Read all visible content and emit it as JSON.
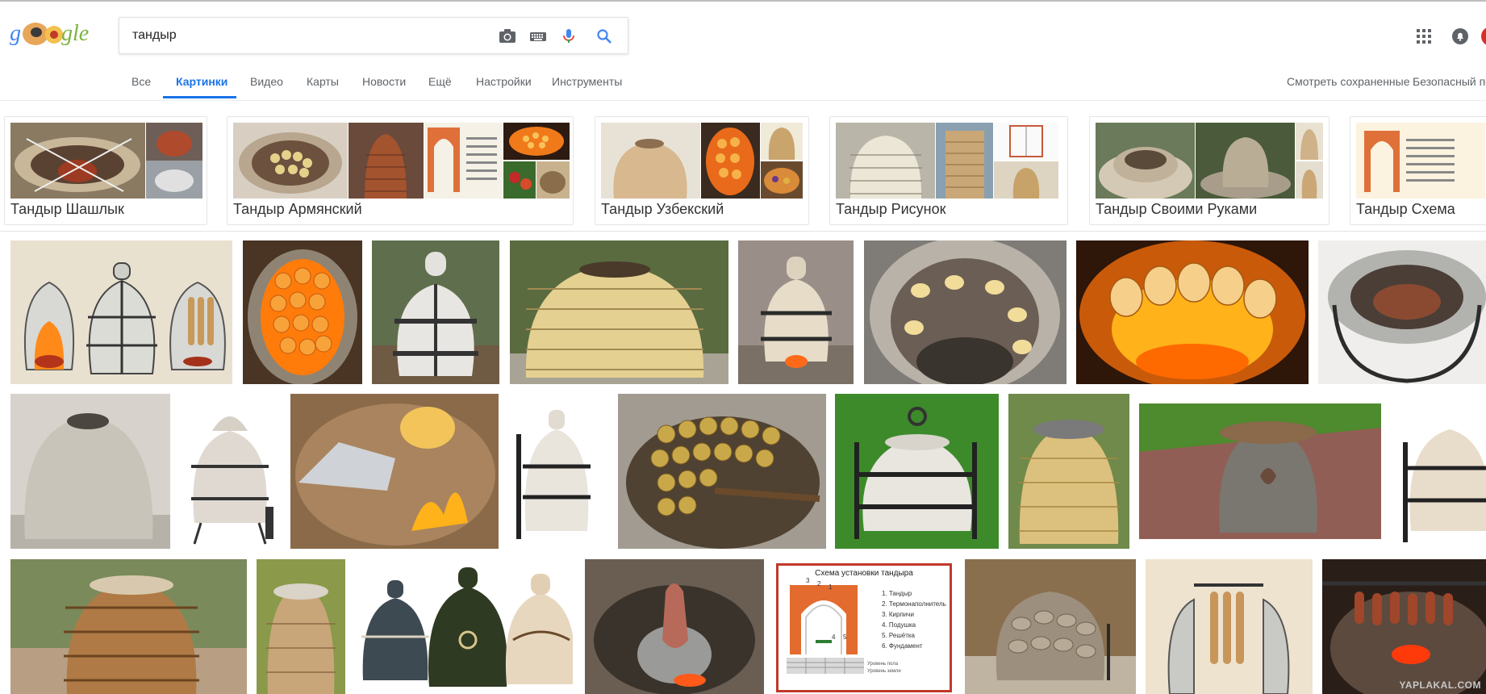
{
  "header": {
    "logo_text": "gle",
    "search_query": "тандыр",
    "icons": [
      "camera-icon",
      "keyboard-icon",
      "mic-icon",
      "search-icon",
      "apps-icon",
      "notifications-icon"
    ],
    "colors": {
      "accent": "#1a73e8",
      "mic_blue": "#4285f4",
      "mic_red": "#ea4335"
    }
  },
  "tabs": [
    {
      "label": "Все",
      "active": false
    },
    {
      "label": "Картинки",
      "active": true
    },
    {
      "label": "Видео",
      "active": false
    },
    {
      "label": "Карты",
      "active": false
    },
    {
      "label": "Новости",
      "active": false
    },
    {
      "label": "Ещё",
      "active": false
    },
    {
      "label": "Настройки",
      "active": false
    },
    {
      "label": "Инструменты",
      "active": false
    }
  ],
  "right_links": {
    "saved": "Смотреть сохраненные",
    "safe_search": "Безопасный по"
  },
  "related": [
    {
      "label": "Тандыр Шашлык"
    },
    {
      "label": "Тандыр Армянский"
    },
    {
      "label": "Тандыр Узбекский"
    },
    {
      "label": "Тандыр Рисунок"
    },
    {
      "label": "Тандыр Своими Руками"
    },
    {
      "label": "Тандыр Схема"
    }
  ],
  "diagram": {
    "title": "Схема установки тандыра",
    "items": [
      "1. Тандыр",
      "2. Термонаполнитель",
      "3. Кирпичи",
      "4. Подушка",
      "5. Решётка",
      "6. Фундамент"
    ],
    "bottom": [
      "Уровень пола",
      "Уровень земли"
    ],
    "nums": [
      "3",
      "2",
      "1",
      "4",
      "5"
    ]
  },
  "watermarks": {
    "yaplakal": "YAPLAKAL.COM"
  }
}
